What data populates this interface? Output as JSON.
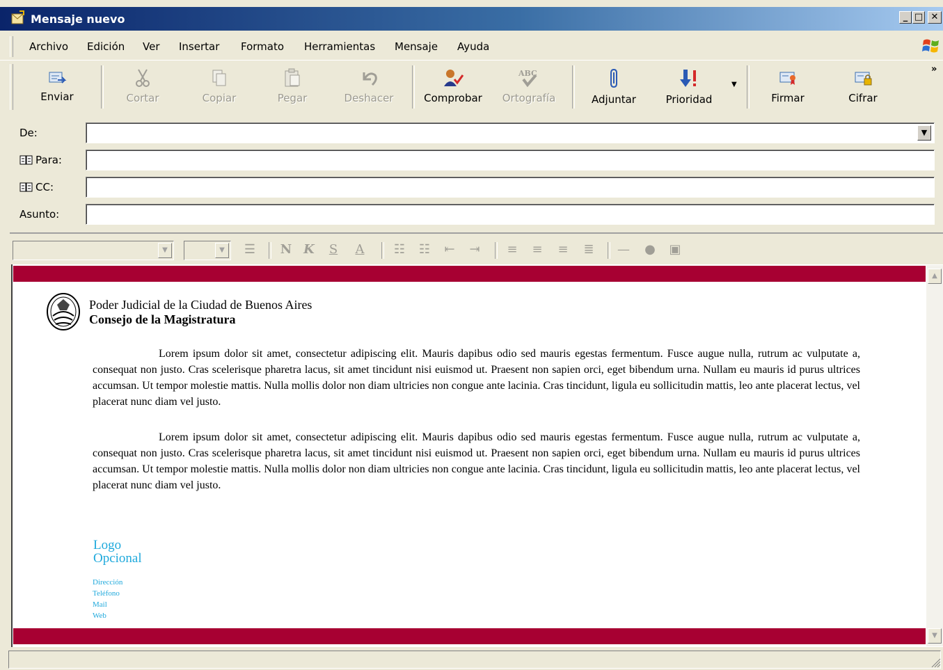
{
  "window": {
    "title": "Mensaje nuevo",
    "icon": "new-message-icon",
    "caption_buttons": [
      "_",
      "□",
      "✕"
    ]
  },
  "menu": {
    "items": [
      "Archivo",
      "Edición",
      "Ver",
      "Insertar",
      "Formato",
      "Herramientas",
      "Mensaje",
      "Ayuda"
    ]
  },
  "toolbar": {
    "buttons": [
      {
        "label": "Enviar",
        "icon": "send-icon",
        "enabled": true
      },
      {
        "label": "Cortar",
        "icon": "scissors-icon",
        "enabled": false
      },
      {
        "label": "Copiar",
        "icon": "copy-icon",
        "enabled": false
      },
      {
        "label": "Pegar",
        "icon": "paste-icon",
        "enabled": false
      },
      {
        "label": "Deshacer",
        "icon": "undo-icon",
        "enabled": false
      },
      {
        "label": "Comprobar",
        "icon": "check-names-icon",
        "enabled": true
      },
      {
        "label": "Ortografía",
        "icon": "spelling-icon",
        "enabled": false
      },
      {
        "label": "Adjuntar",
        "icon": "paperclip-icon",
        "enabled": true
      },
      {
        "label": "Prioridad",
        "icon": "priority-icon",
        "enabled": true
      },
      {
        "label": "Firmar",
        "icon": "sign-icon",
        "enabled": true
      },
      {
        "label": "Cifrar",
        "icon": "encrypt-icon",
        "enabled": true
      }
    ],
    "overflow": "»"
  },
  "header": {
    "from_label": "De:",
    "to_label": "Para:",
    "cc_label": "CC:",
    "subject_label": "Asunto:",
    "from_value": "",
    "to_value": "",
    "cc_value": "",
    "subject_value": ""
  },
  "format_toolbar": {
    "buttons": [
      "N",
      "K",
      "S",
      "A"
    ]
  },
  "body": {
    "org_line1": "Poder Judicial de la Ciudad de Buenos Aires",
    "org_line2": "Consejo de la Magistratura",
    "paragraph1": "Lorem ipsum dolor sit amet, consectetur adipiscing elit. Mauris dapibus odio sed mauris egestas fermentum. Fusce augue nulla, rutrum ac vulputate a, consequat non justo. Cras scelerisque pharetra lacus, sit amet tincidunt nisi euismod ut. Praesent non sapien orci, eget bibendum urna. Nullam eu mauris id purus ultrices accumsan. Ut tempor molestie mattis. Nulla mollis dolor non diam ultricies non congue ante lacinia. Cras tincidunt, ligula eu sollicitudin mattis, leo ante placerat lectus, vel placerat nunc diam vel justo.",
    "paragraph2": "Lorem ipsum dolor sit amet, consectetur adipiscing elit. Mauris dapibus odio sed mauris egestas fermentum. Fusce augue nulla, rutrum ac vulputate a, consequat non justo. Cras scelerisque pharetra lacus, sit amet tincidunt nisi euismod ut. Praesent non sapien orci, eget bibendum urna. Nullam eu mauris id purus ultrices accumsan. Ut tempor molestie mattis. Nulla mollis dolor non diam ultricies non congue ante lacinia. Cras tincidunt, ligula eu sollicitudin mattis, leo ante placerat lectus, vel placerat nunc diam vel justo.",
    "logo_line1": "Logo",
    "logo_line2": "Opcional",
    "contact": [
      "Dirección",
      "Teléfono",
      "Mail",
      "Web"
    ]
  },
  "colors": {
    "brand_red": "#a70032",
    "link_cyan": "#1fa9dc",
    "titlebar_start": "#0a246a",
    "titlebar_end": "#a6caf0"
  }
}
